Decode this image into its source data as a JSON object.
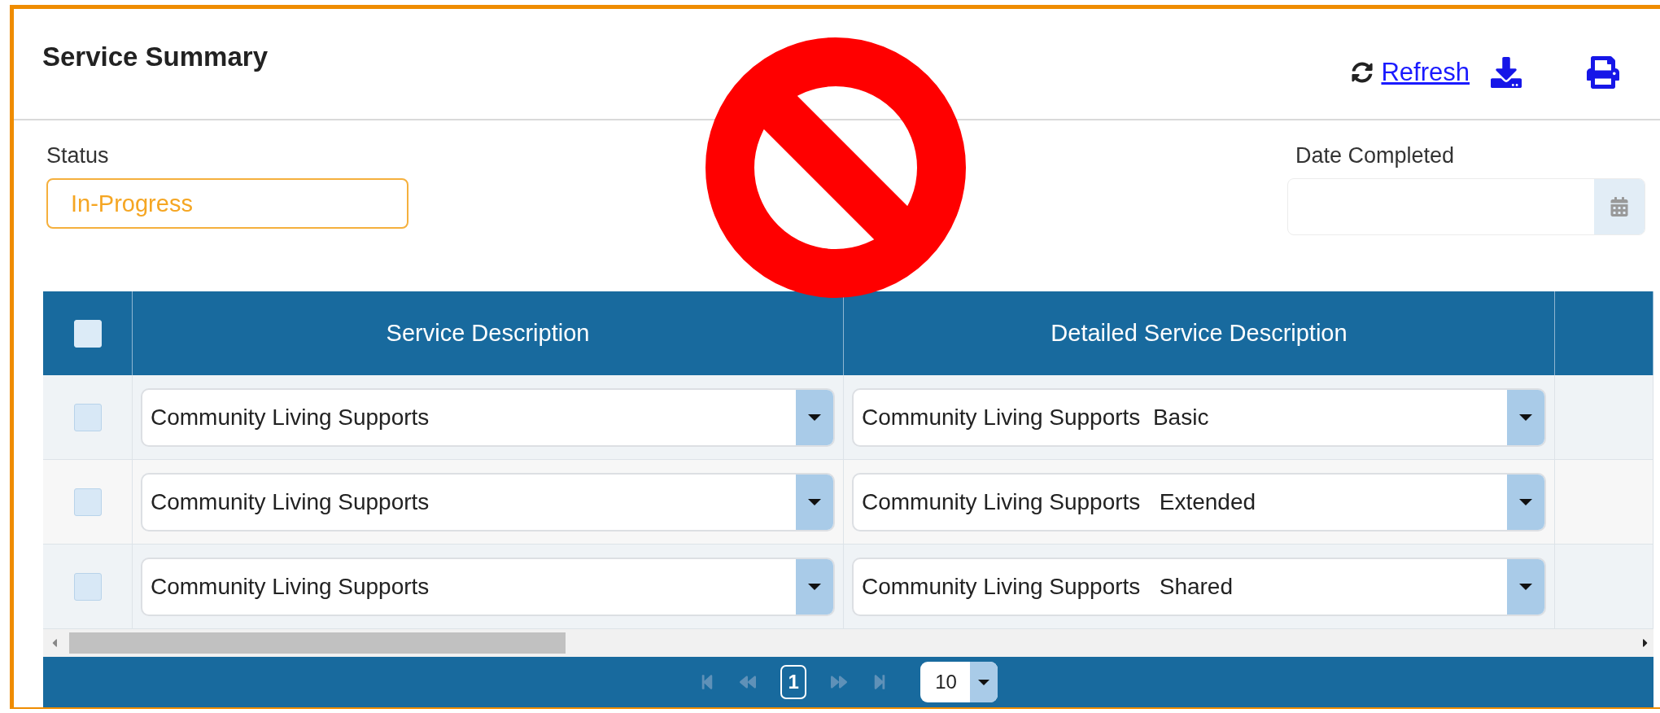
{
  "header": {
    "title": "Service Summary",
    "refresh_link": "Refresh"
  },
  "status": {
    "label": "Status",
    "value": "In-Progress"
  },
  "date_completed": {
    "label": "Date Completed"
  },
  "table": {
    "columns": [
      "Service Description",
      "Detailed Service Description"
    ],
    "header_checked": false,
    "rows": [
      {
        "checked": false,
        "service": "Community Living Supports",
        "detail": "Community Living Supports  Basic"
      },
      {
        "checked": false,
        "service": "Community Living Supports",
        "detail": "Community Living Supports   Extended"
      },
      {
        "checked": false,
        "service": "Community Living Supports",
        "detail": "Community Living Supports   Shared"
      }
    ]
  },
  "pager": {
    "pages": [
      {
        "label": "1",
        "selected": true
      }
    ],
    "page_size": "10"
  }
}
